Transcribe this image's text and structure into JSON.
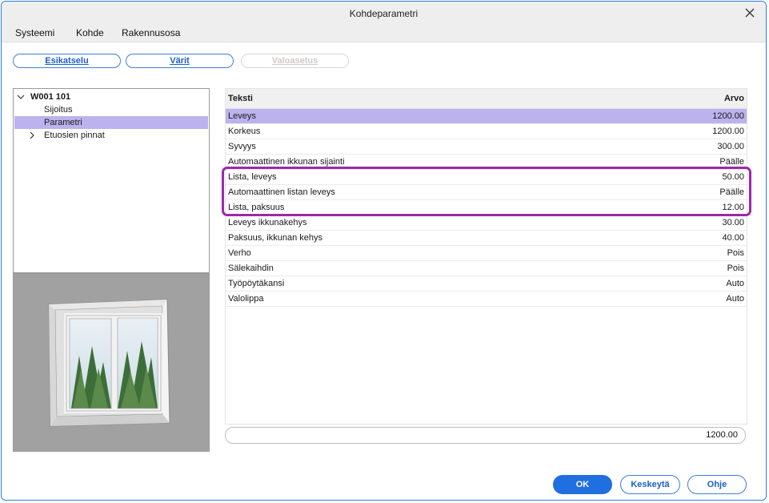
{
  "window": {
    "title": "Kohdeparametri"
  },
  "menu": {
    "items": [
      "Systeemi",
      "Kohde",
      "Rakennusosa"
    ]
  },
  "toolbar": {
    "preview_label": "Esikatselu",
    "colors_label": "Värit",
    "lighting_label": "Valoasetus"
  },
  "tree": {
    "root": "W001 101",
    "items": [
      "Sijoitus",
      "Parametri",
      "Etuosien pinnat"
    ]
  },
  "grid": {
    "header_text": "Teksti",
    "header_value": "Arvo",
    "rows": [
      {
        "text": "Leveys",
        "value": "1200.00"
      },
      {
        "text": "Korkeus",
        "value": "1200.00"
      },
      {
        "text": "Syvyys",
        "value": "300.00"
      },
      {
        "text": "Automaattinen ikkunan sijainti",
        "value": "Päälle"
      },
      {
        "text": "Lista, leveys",
        "value": "50.00"
      },
      {
        "text": "Automaattinen listan leveys",
        "value": "Päälle"
      },
      {
        "text": "Lista, paksuus",
        "value": "12.00"
      },
      {
        "text": "Leveys ikkunakehys",
        "value": "30.00"
      },
      {
        "text": "Paksuus, ikkunan kehys",
        "value": "40.00"
      },
      {
        "text": "Verho",
        "value": "Pois"
      },
      {
        "text": "Sälekaihdin",
        "value": "Pois"
      },
      {
        "text": "Työpöytäkansi",
        "value": "Auto"
      },
      {
        "text": "Valolippa",
        "value": "Auto"
      }
    ]
  },
  "value_field": {
    "value": "1200.00"
  },
  "buttons": {
    "ok": "OK",
    "cancel": "Keskeytä",
    "help": "Ohje"
  },
  "colors": {
    "accent": "#1f6fe0",
    "selection": "#bcb2ee",
    "highlight": "#9b2aa8"
  }
}
